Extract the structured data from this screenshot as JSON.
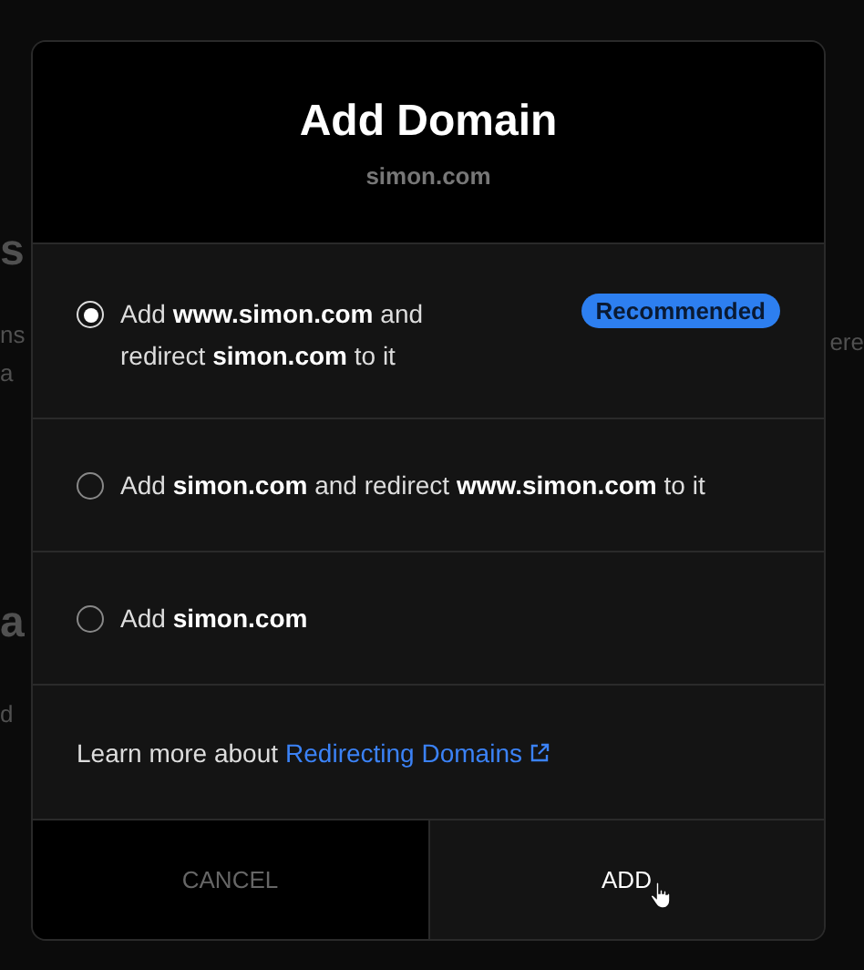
{
  "backdrop": {
    "left_fragments": [
      {
        "text": "s",
        "kind": "heading"
      },
      {
        "text": "ns",
        "kind": "body"
      },
      {
        "text": "a",
        "kind": "body"
      },
      {
        "text": "a",
        "kind": "heading"
      },
      {
        "text": "d",
        "kind": "body"
      }
    ],
    "right_fragments": [
      {
        "text": "ere"
      }
    ]
  },
  "dialog": {
    "title": "Add Domain",
    "subtitle": "simon.com",
    "options": [
      {
        "label": "Add **www.simon.com** and redirect **simon.com** to it",
        "selected": true,
        "badge": "Recommended"
      },
      {
        "label": "Add **simon.com** and redirect **www.simon.com** to it",
        "selected": false
      },
      {
        "label": "Add **simon.com**",
        "selected": false
      }
    ],
    "learn_more": {
      "text": "Learn more about",
      "link": "Redirecting Domains"
    },
    "buttons": [
      {
        "label": "CANCEL",
        "kind": "secondary"
      },
      {
        "label": "ADD",
        "kind": "primary",
        "hovered": true
      }
    ]
  }
}
